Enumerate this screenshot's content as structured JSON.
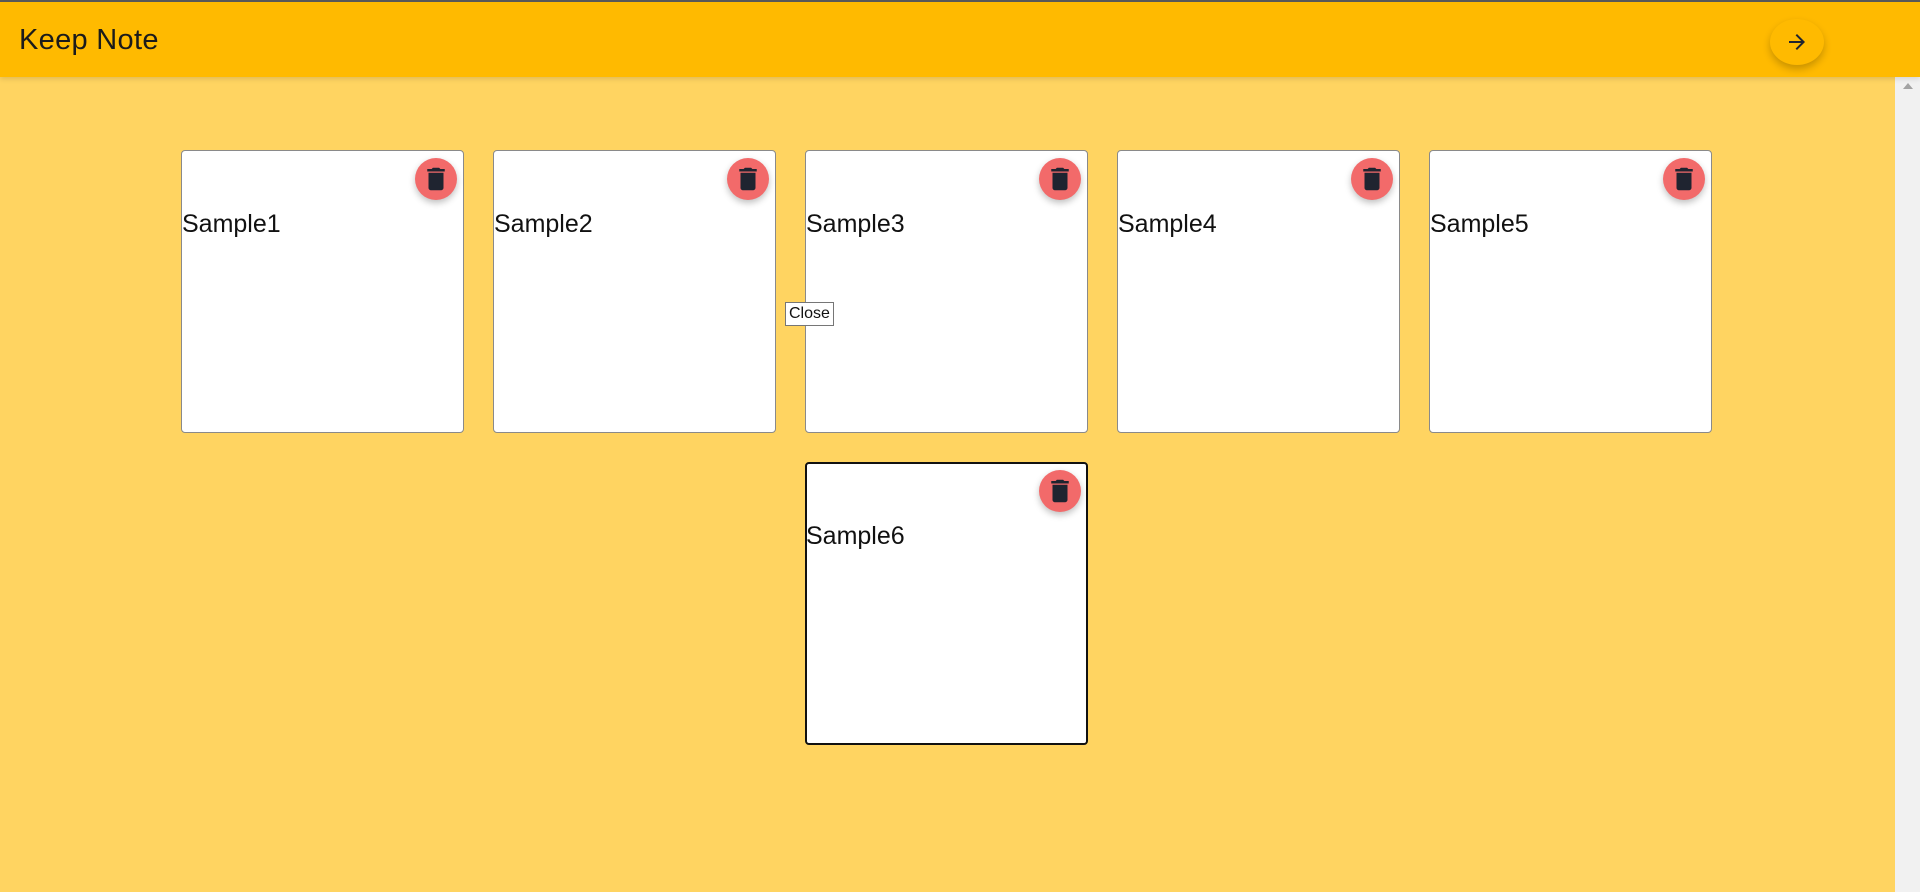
{
  "app_bar": {
    "title": "Keep Note",
    "next_button_icon": "arrow-right-icon"
  },
  "notes": [
    {
      "text": "Sample1",
      "delete_icon": "trash-icon"
    },
    {
      "text": "Sample2",
      "delete_icon": "trash-icon"
    },
    {
      "text": "Sample3",
      "delete_icon": "trash-icon"
    },
    {
      "text": "Sample4",
      "delete_icon": "trash-icon"
    },
    {
      "text": "Sample5",
      "delete_icon": "trash-icon"
    },
    {
      "text": "Sample6",
      "delete_icon": "trash-icon",
      "focused": true
    }
  ],
  "tooltip": {
    "text": "Close"
  },
  "colors": {
    "app_bar_bg": "#ffba00",
    "page_bg": "#ffd461",
    "card_bg": "#ffffff",
    "delete_button_bg": "#f26a6a",
    "icon_color": "#1f2430"
  }
}
